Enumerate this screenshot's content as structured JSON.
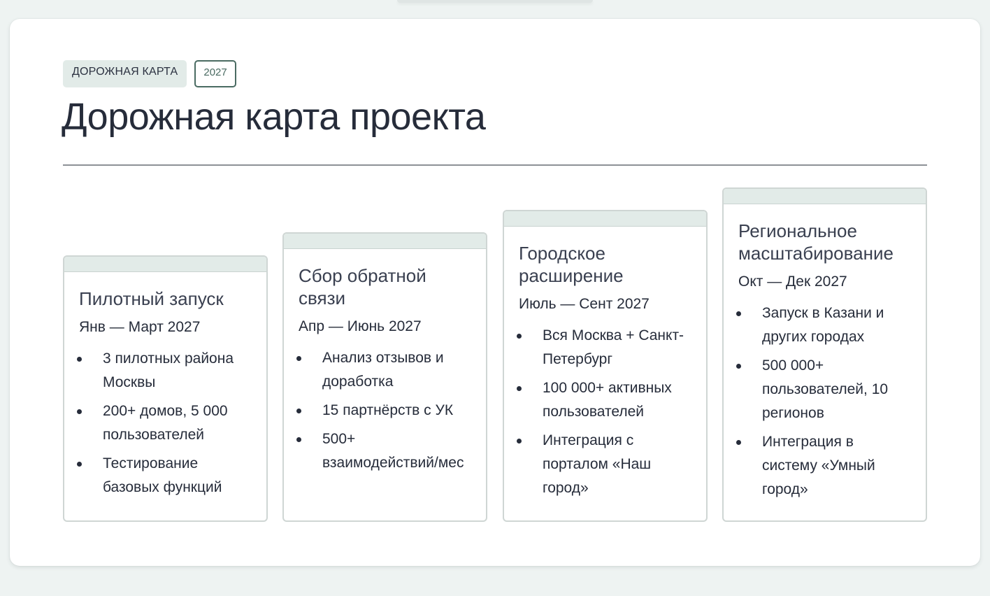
{
  "header": {
    "tag_label": "ДОРОЖНАЯ КАРТА",
    "tag_year": "2027",
    "title": "Дорожная карта проекта"
  },
  "phases": [
    {
      "title": "Пилотный запуск",
      "dates": "Янв — Март 2027",
      "items": [
        "3 пилотных района Москвы",
        "200+ домов, 5 000 пользователей",
        "Тестирование базовых функций"
      ]
    },
    {
      "title": "Сбор обратной связи",
      "dates": "Апр — Июнь 2027",
      "items": [
        "Анализ отзывов и доработка",
        "15 партнёрств с УК",
        "500+ взаимодействий/мес"
      ]
    },
    {
      "title": "Городское расширение",
      "dates": "Июль — Сент 2027",
      "items": [
        "Вся Москва + Санкт-Петербург",
        "100 000+ активных пользователей",
        "Интеграция с порталом «Наш город»"
      ]
    },
    {
      "title": "Региональное масштабирование",
      "dates": "Окт — Дек 2027",
      "items": [
        "Запуск в Казани и других городах",
        "500 000+ пользователей, 10 регионов",
        "Интеграция в систему «Умный город»"
      ]
    }
  ],
  "colors": {
    "accent_bar": "#e2ebe8",
    "year_border": "#4a6b62",
    "text": "#262c3a"
  }
}
